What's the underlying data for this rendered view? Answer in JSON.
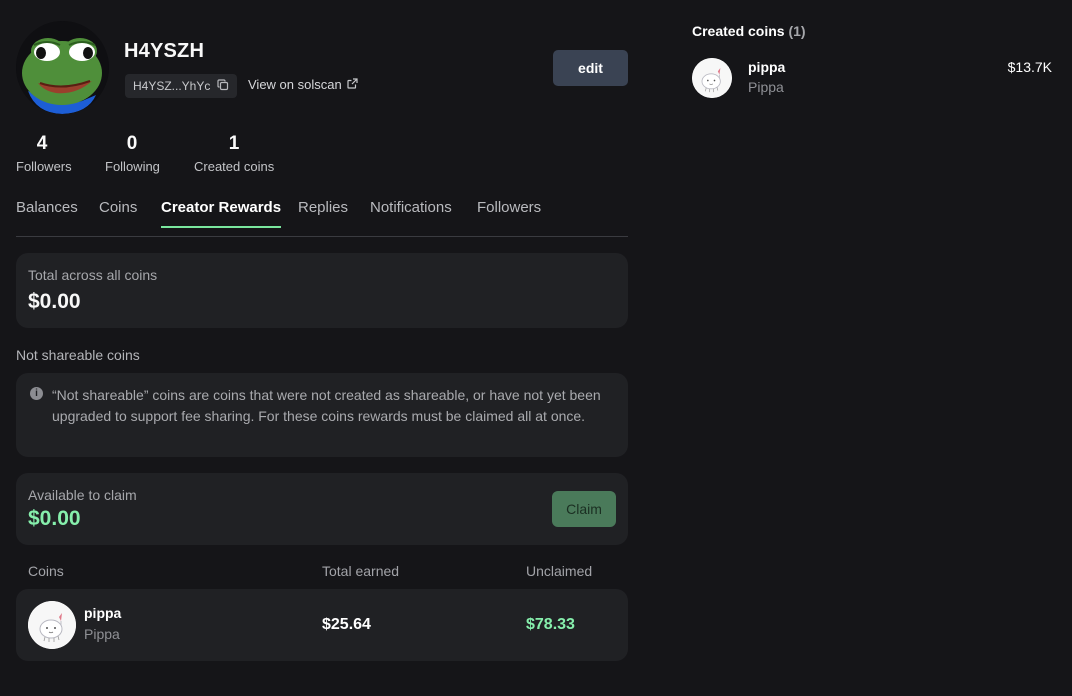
{
  "profile": {
    "username": "H4YSZH",
    "address_short": "H4YSZ...YhYc",
    "solscan_label": "View on solscan",
    "edit_label": "edit"
  },
  "stats": [
    {
      "value": "4",
      "label": "Followers"
    },
    {
      "value": "0",
      "label": "Following"
    },
    {
      "value": "1",
      "label": "Created coins"
    }
  ],
  "tabs": [
    {
      "label": "Balances",
      "active": false
    },
    {
      "label": "Coins",
      "active": false
    },
    {
      "label": "Creator Rewards",
      "active": true
    },
    {
      "label": "Replies",
      "active": false
    },
    {
      "label": "Notifications",
      "active": false
    },
    {
      "label": "Followers",
      "active": false
    }
  ],
  "rewards": {
    "total_label": "Total across all coins",
    "total_value": "$0.00",
    "not_shareable_label": "Not shareable coins",
    "info_text": "“Not shareable” coins are coins that were not created as shareable, or have not yet been upgraded to support fee sharing. For these coins rewards must be claimed all at once.",
    "claim_label": "Available to claim",
    "claim_value": "$0.00",
    "claim_button": "Claim",
    "table": {
      "headers": [
        "Coins",
        "Total earned",
        "Unclaimed"
      ],
      "rows": [
        {
          "name": "pippa",
          "ticker": "Pippa",
          "earned": "$25.64",
          "unclaimed": "$78.33"
        }
      ]
    }
  },
  "created_coins": {
    "title": "Created coins",
    "count": "(1)",
    "items": [
      {
        "name": "pippa",
        "ticker": "Pippa",
        "market_cap": "$13.7K"
      }
    ]
  },
  "colors": {
    "background": "#151518",
    "card": "#202124",
    "accent_green": "#86efac",
    "tab_underline": "#7ae79e",
    "edit_button": "#3a4353",
    "claim_button": "#4a7a5a"
  },
  "icons": [
    "copy-icon",
    "external-link-icon",
    "info-icon",
    "pepe-avatar",
    "pippa-coin-icon"
  ]
}
